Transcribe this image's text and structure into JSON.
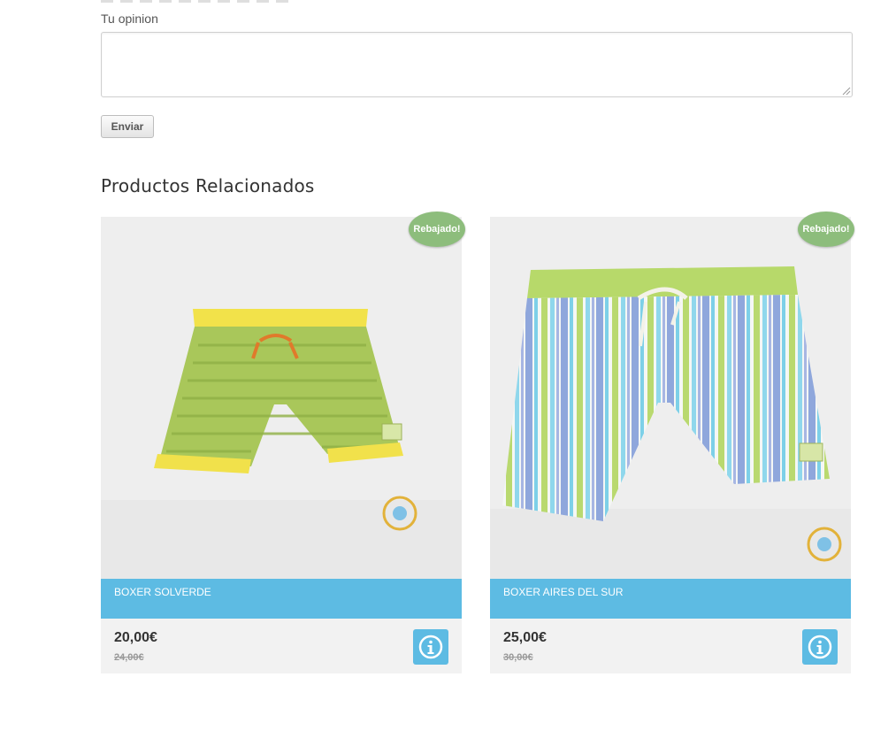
{
  "review_form": {
    "label": "Tu opinion",
    "textarea_value": "",
    "submit_label": "Enviar"
  },
  "related": {
    "title": "Productos Relacionados",
    "products": [
      {
        "name": "BOXER SOLVERDE",
        "price": "20,00€",
        "old_price": "24,00€",
        "badge": "Rebajado!",
        "image_desc": "green patterned swim boxer with yellow trim"
      },
      {
        "name": "BOXER AIRES DEL SUR",
        "price": "25,00€",
        "old_price": "30,00€",
        "badge": "Rebajado!",
        "image_desc": "blue, white and green striped swim boxer"
      }
    ]
  },
  "colors": {
    "accent_blue": "#5dbbe3",
    "badge_green": "#8dbd7c",
    "card_background": "#f2f2f2"
  },
  "icons": {
    "info": "info-circle-icon",
    "resize": "resize-grip-icon"
  }
}
